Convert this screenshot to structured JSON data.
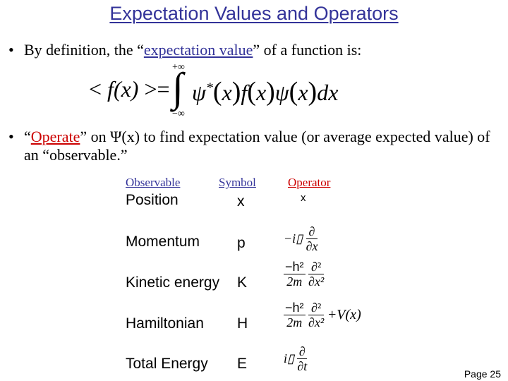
{
  "slide": {
    "title": "Expectation Values and Operators",
    "bullets": [
      {
        "marker": "•",
        "prefix": "By definition, the “",
        "link": "expectation value",
        "suffix": "” of a function is:"
      },
      {
        "marker": "•",
        "prefix": "“",
        "link": "Operate",
        "suffix": "” on Ψ(x) to find expectation value (or average expected value)  of an “observable.”"
      }
    ],
    "formula": {
      "lhs": "< f(x) >=",
      "upper_limit": "+∞",
      "lower_limit": "−∞",
      "integral": "∫",
      "integrand": "ψ*(x) f(x) ψ(x) dx"
    },
    "table": {
      "headers": [
        "Observable",
        "Symbol",
        "Operator"
      ],
      "rows": [
        {
          "observable": "Position",
          "symbol": "x",
          "operator": "x"
        },
        {
          "observable": "Momentum",
          "symbol": "p",
          "operator": "−iℏ ∂/∂x"
        },
        {
          "observable": "Kinetic energy",
          "symbol": "K",
          "operator": "−ℏ²/2m ∂²/∂x²"
        },
        {
          "observable": "Hamiltonian",
          "symbol": "H",
          "operator": "−ℏ²/2m ∂²/∂x² + V(x)"
        },
        {
          "observable": "Total Energy",
          "symbol": "E",
          "operator": "iℏ ∂/∂t"
        }
      ],
      "operator_parts": {
        "momentum": {
          "prefix": "−i▯",
          "num": "∂",
          "den": "∂x"
        },
        "kinetic": {
          "num1": "−h²",
          "den1": "2m",
          "num2": "∂²",
          "den2": "∂x²"
        },
        "hamiltonian": {
          "num1": "−h²",
          "den1": "2m",
          "num2": "∂²",
          "den2": "∂x²",
          "suffix": "+V(x)"
        },
        "total_energy": {
          "prefix": "i▯",
          "num": "∂",
          "den": "∂t"
        }
      }
    },
    "footer": {
      "page": "Page 25"
    },
    "colors": {
      "title": "#333399",
      "link_blue": "#333399",
      "link_red": "#cc0000"
    }
  }
}
